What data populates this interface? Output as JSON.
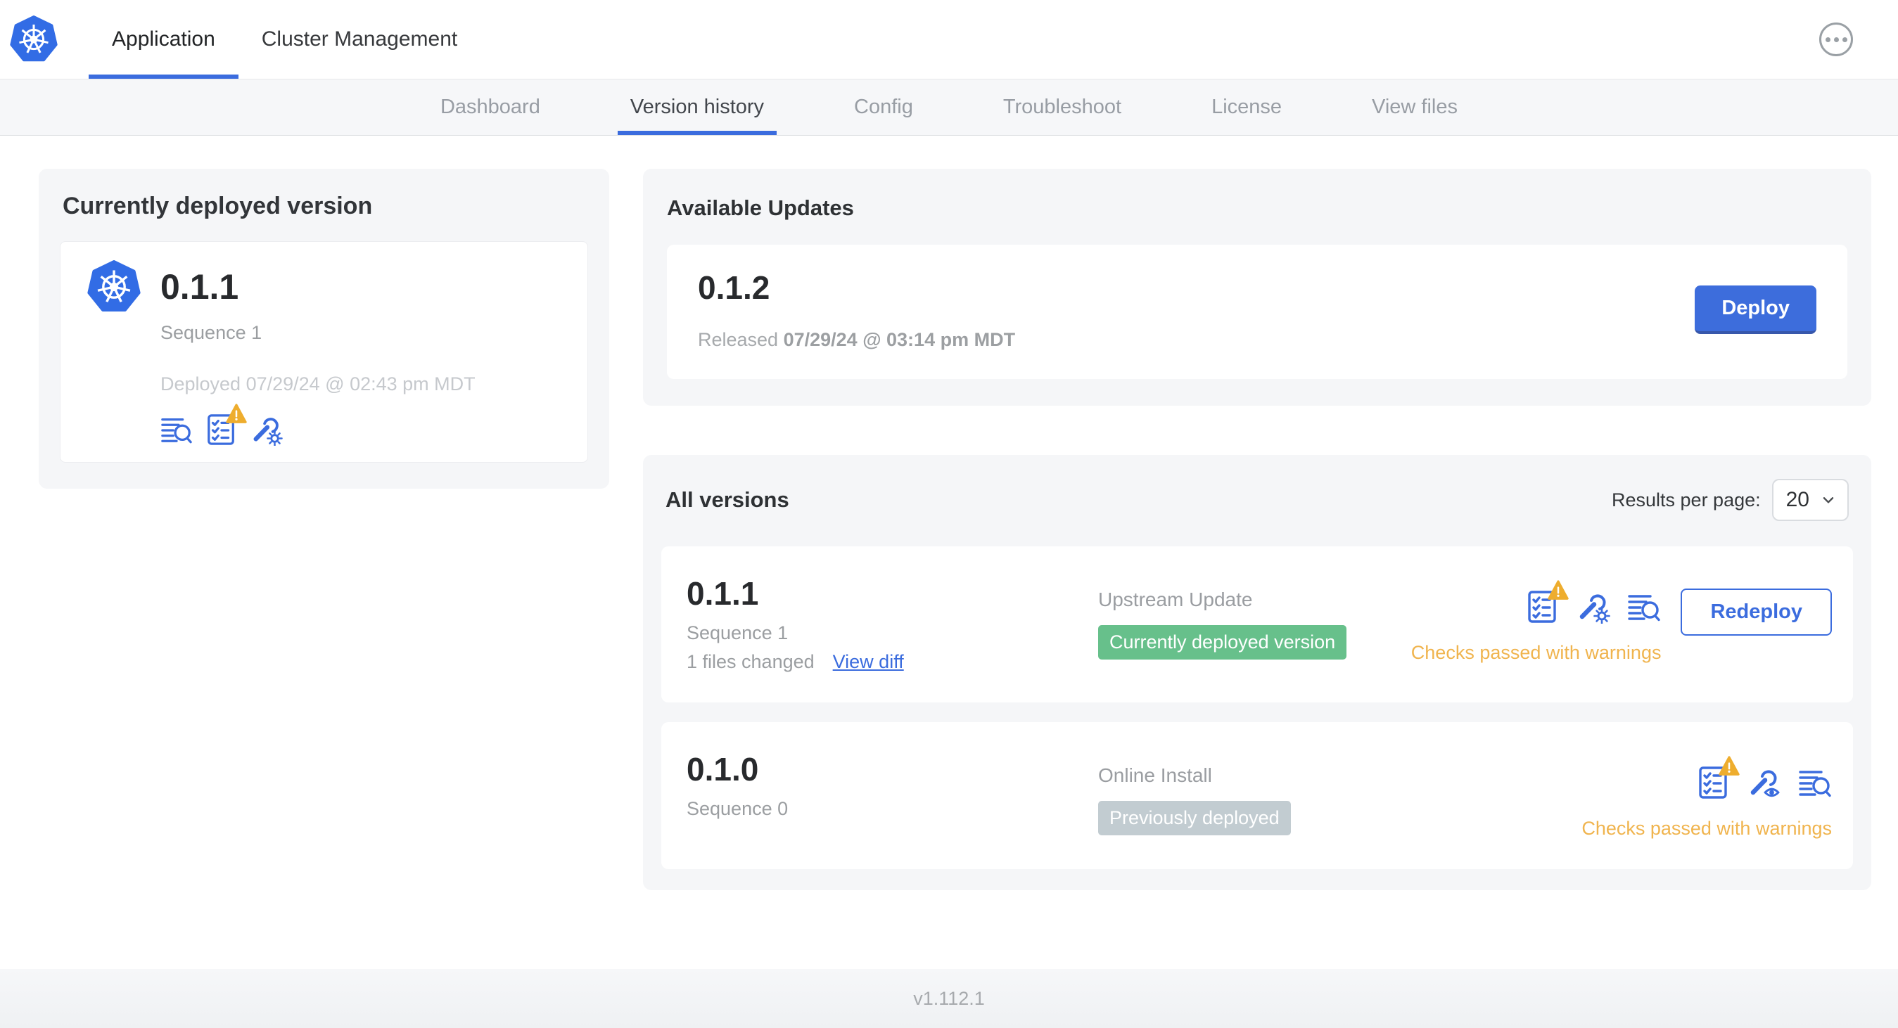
{
  "header": {
    "tabs": [
      {
        "label": "Application",
        "active": true
      },
      {
        "label": "Cluster Management",
        "active": false
      }
    ],
    "menu_icon": "ellipsis-icon"
  },
  "subnav": {
    "tabs": [
      {
        "label": "Dashboard",
        "active": false
      },
      {
        "label": "Version history",
        "active": true
      },
      {
        "label": "Config",
        "active": false
      },
      {
        "label": "Troubleshoot",
        "active": false
      },
      {
        "label": "License",
        "active": false
      },
      {
        "label": "View files",
        "active": false
      }
    ]
  },
  "current_version": {
    "title": "Currently deployed version",
    "version": "0.1.1",
    "sequence": "Sequence 1",
    "deployed": "Deployed 07/29/24 @ 02:43 pm MDT",
    "icons": [
      "diff-icon",
      "preflight-checks-warning-icon",
      "edit-config-icon"
    ]
  },
  "available_updates": {
    "title": "Available Updates",
    "version": "0.1.2",
    "released_prefix": "Released",
    "released_date": "07/29/24 @ 03:14 pm MDT",
    "deploy_label": "Deploy"
  },
  "all_versions": {
    "title": "All versions",
    "results_per_page_label": "Results per page:",
    "results_per_page_value": "20",
    "rows": [
      {
        "version": "0.1.1",
        "sequence": "Sequence 1",
        "files_changed": "1 files changed",
        "view_diff_label": "View diff",
        "source": "Upstream Update",
        "badge": "Currently deployed version",
        "badge_color": "green",
        "status": "Checks passed with warnings",
        "action_label": "Redeploy",
        "icons": [
          "preflight-checks-warning-icon",
          "edit-config-icon",
          "diff-icon"
        ]
      },
      {
        "version": "0.1.0",
        "sequence": "Sequence 0",
        "source": "Online Install",
        "badge": "Previously deployed",
        "badge_color": "gray",
        "status": "Checks passed with warnings",
        "icons": [
          "preflight-checks-warning-icon",
          "view-config-icon",
          "diff-icon"
        ]
      }
    ]
  },
  "footer": {
    "app_version": "v1.112.1"
  },
  "colors": {
    "accent_blue": "#3b6cde",
    "kubernetes_blue": "#326ce5",
    "badge_green": "#67c08b",
    "badge_gray": "#c2ccd1",
    "warning_amber": "#f0b44e",
    "panel_gray": "#f5f6f8"
  }
}
